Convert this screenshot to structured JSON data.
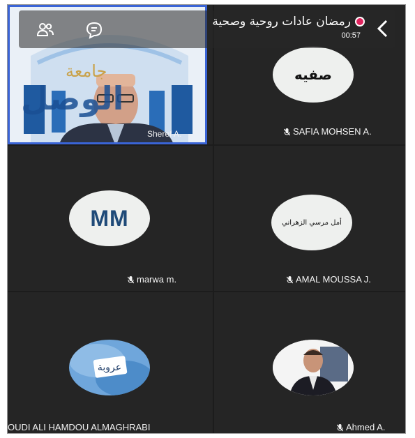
{
  "meeting": {
    "title": "رمضان عادات روحية وصحية",
    "timer": "00:57"
  },
  "colors": {
    "background": "#252525",
    "accent_border": "#3a64d6",
    "record_dot": "#e0245e",
    "avatar_bg": "#eef0ee",
    "mm_text": "#1f4a78"
  },
  "icons": {
    "back": "chevron-left-icon",
    "chat": "chat-bubble-icon",
    "participants": "people-icon",
    "muted": "mic-off-icon"
  },
  "participants": [
    {
      "id": "sheref",
      "name": "Sheref A.",
      "video": true,
      "backdrop_text_top": "جامعة",
      "backdrop_text_bottom": "الوصل"
    },
    {
      "id": "safia",
      "name": "SAFIA MOHSEN A.",
      "avatar_text": "صفيه",
      "muted": true
    },
    {
      "id": "marwa",
      "name": "marwa m.",
      "avatar_text": "MM",
      "muted": true
    },
    {
      "id": "amal",
      "name": "AMAL MOUSSA J.",
      "avatar_text": "أمل مرسي الزهراني",
      "muted": true
    },
    {
      "id": "oudi",
      "name": "OUDI ALI HAMDOU ALMAGHRABI",
      "avatar_text": "عروبة",
      "muted": false
    },
    {
      "id": "ahmed",
      "name": "Ahmed A.",
      "muted": true
    }
  ]
}
